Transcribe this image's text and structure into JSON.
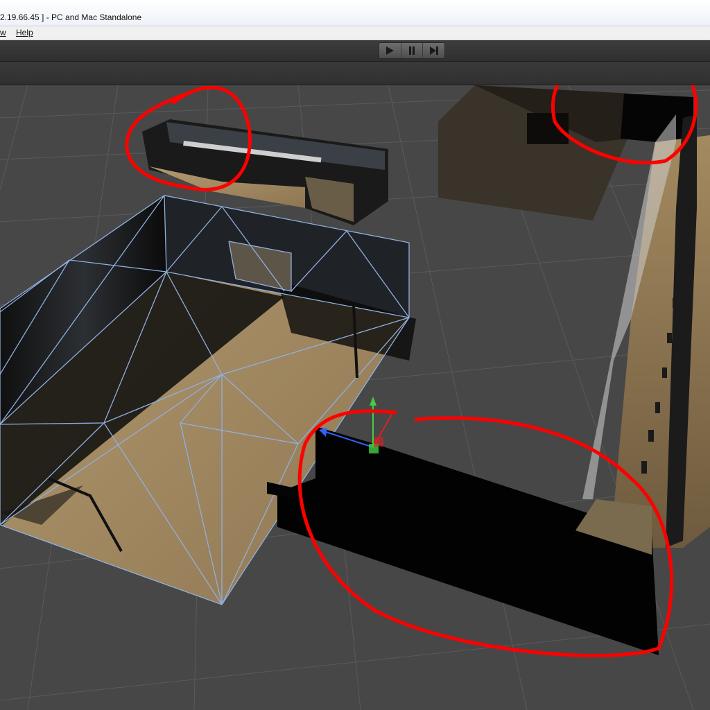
{
  "window": {
    "title": "2.19.66.45 ] - PC and Mac Standalone"
  },
  "menu": {
    "items": [
      "w",
      "Help"
    ]
  },
  "toolbar": {
    "play_icon": "play-icon",
    "pause_icon": "pause-icon",
    "step_icon": "step-icon"
  },
  "scene": {
    "annotation_color": "#ff0000",
    "grid_color": "#5a5a5a",
    "floor_color": "#a89068",
    "wireframe_color": "#8fb0e0",
    "gizmo_colors": {
      "x": "#e02020",
      "y": "#40d040",
      "z": "#3060ff"
    }
  }
}
